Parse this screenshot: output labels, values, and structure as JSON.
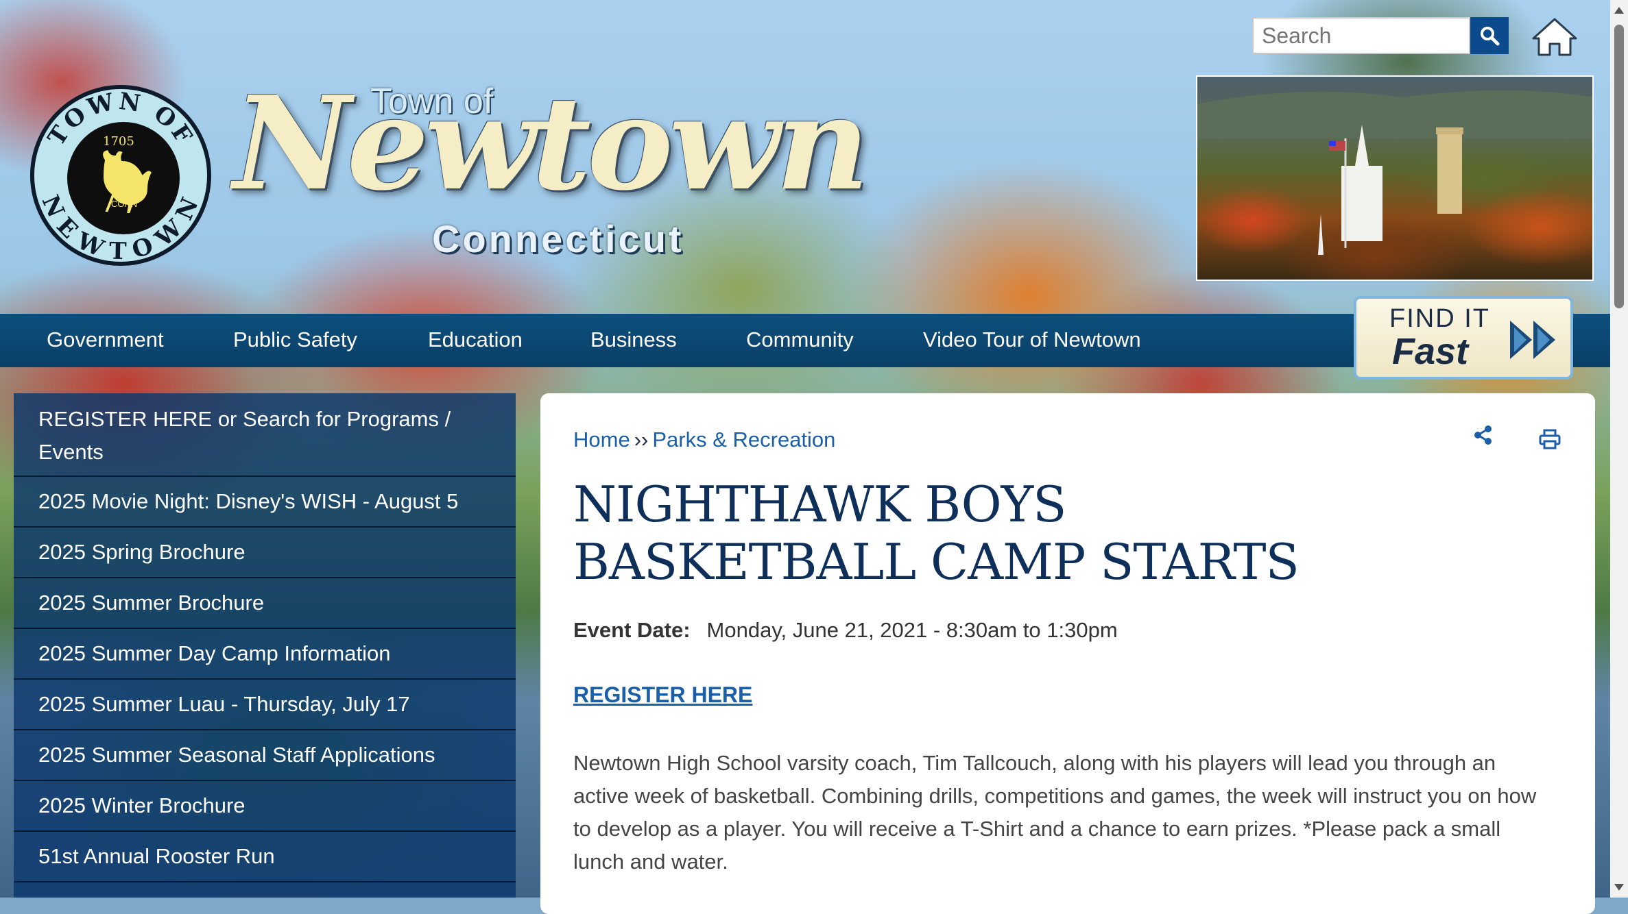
{
  "header": {
    "logo_text_small": "Town of",
    "logo_text_big": "Newtown",
    "logo_text_state": "Connecticut",
    "seal_top": "TOWN OF",
    "seal_bottom": "NEWTOWN",
    "seal_year": "1705",
    "seal_conn": "CONN",
    "search_placeholder": "Search"
  },
  "nav": {
    "items": [
      "Government",
      "Public Safety",
      "Education",
      "Business",
      "Community",
      "Video Tour of Newtown"
    ],
    "find_it": "FIND IT",
    "fast": "Fast"
  },
  "sidebar": {
    "items": [
      "REGISTER HERE or Search for Programs / Events",
      "2025 Movie Night: Disney's WISH - August 5",
      "2025 Spring Brochure",
      "2025 Summer Brochure",
      "2025 Summer Day Camp Information",
      "2025 Summer Luau - Thursday, July 17",
      "2025 Summer Seasonal Staff Applications",
      "2025 Winter Brochure",
      "51st Annual Rooster Run"
    ]
  },
  "main": {
    "breadcrumb_home": "Home",
    "breadcrumb_sep": "››",
    "breadcrumb_section": "Parks & Recreation",
    "title": "NIGHTHAWK BOYS BASKETBALL CAMP STARTS",
    "event_label": "Event Date:",
    "event_value": "Monday, June 21, 2021 - 8:30am to 1:30pm",
    "register_link": "REGISTER HERE",
    "body": "Newtown High School varsity coach, Tim Tallcouch, along with his players will lead you through an active week of basketball. Combining drills, competitions and games, the week will instruct you on how to develop as a player. You will receive a T-Shirt and a chance to earn prizes. *Please pack a small lunch and water."
  },
  "colors": {
    "nav_bg": "#0d4f7d",
    "sidebar_bg": "#0c386c",
    "title": "#0e2f5a",
    "link": "#1a5fa8",
    "search_button": "#0b4a8c"
  },
  "icons": [
    "search-icon",
    "home-icon",
    "share-icon",
    "print-icon",
    "double-chevron-icon",
    "rooster-icon"
  ]
}
